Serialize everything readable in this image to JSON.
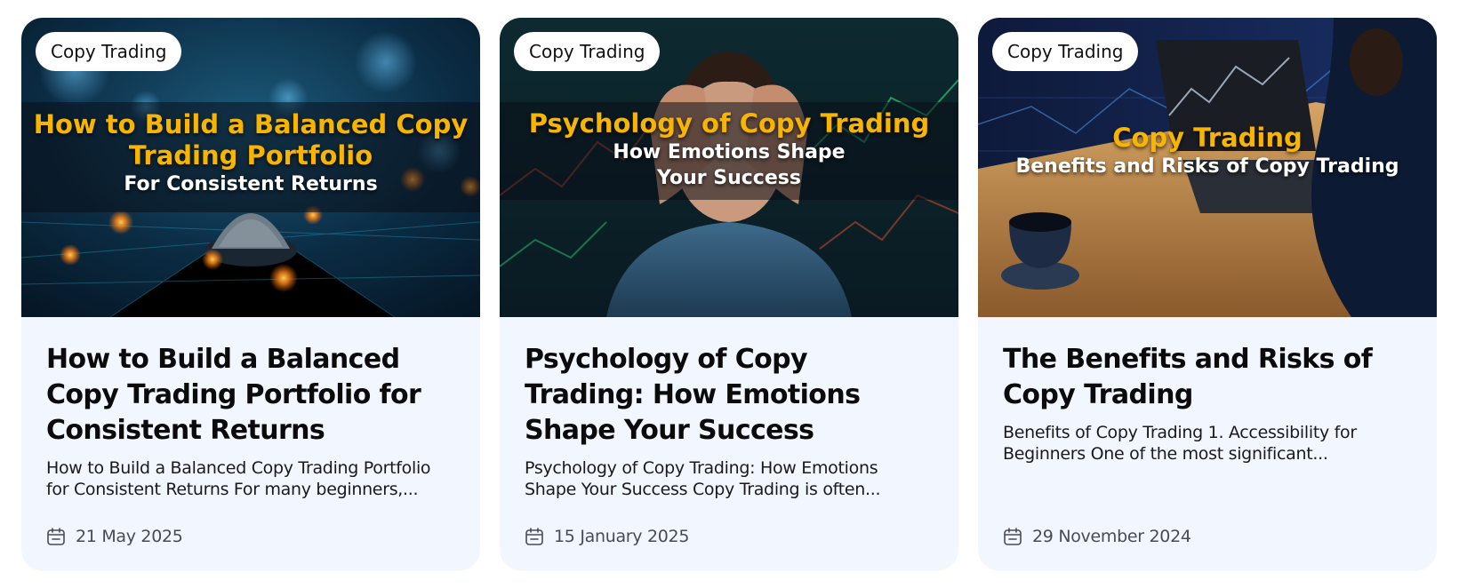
{
  "cards": [
    {
      "badge": "Copy Trading",
      "image_headline_1": "How to Build a Balanced Copy",
      "image_headline_2": "Trading Portfolio",
      "image_sub": "For Consistent Returns",
      "title": "How to Build a Balanced Copy Trading Portfolio for Consistent Returns",
      "excerpt": "How to Build a Balanced Copy Trading Portfolio for Consistent Returns For many beginners,...",
      "date": "21 May 2025"
    },
    {
      "badge": "Copy Trading",
      "image_headline_1": "Psychology of Copy Trading",
      "image_sub_1": "How Emotions Shape",
      "image_sub_2": "Your Success",
      "title": "Psychology of Copy Trading: How Emotions Shape Your Success",
      "excerpt": "Psychology of Copy Trading: How Emotions Shape Your Success Copy Trading is often...",
      "date": "15 January 2025"
    },
    {
      "badge": "Copy Trading",
      "image_headline_1": "Copy Trading",
      "image_sub": "Benefits and Risks of Copy Trading",
      "title": "The Benefits and Risks of Copy Trading",
      "excerpt": "Benefits of Copy Trading 1. Accessibility for Beginners One of the most significant...",
      "date": "29 November 2024"
    }
  ],
  "colors": {
    "card_bg": "#f2f6ff",
    "headline_gold": "#f7b500",
    "title_text": "#0b0b0b",
    "date_text": "#4a4a55"
  },
  "icons": {
    "date": "calendar-icon"
  }
}
